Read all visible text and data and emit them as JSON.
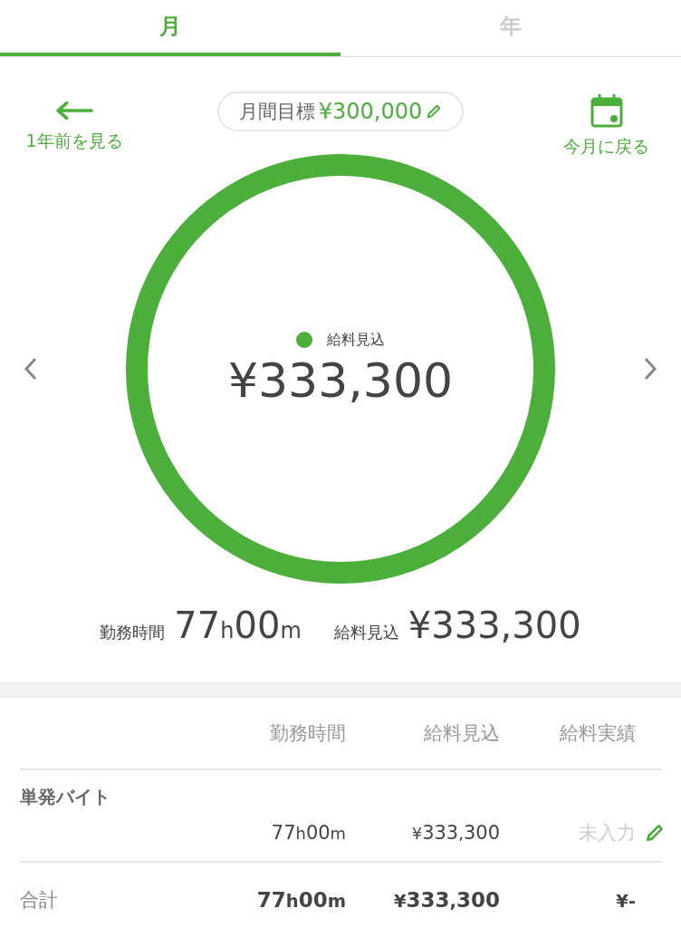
{
  "tabs": [
    {
      "label": "月",
      "selected": true
    },
    {
      "label": "年",
      "selected": false
    }
  ],
  "header": {
    "back_label": "1年前を見る",
    "goal_label": "月間目標",
    "goal_value": "¥300,000",
    "today_label": "今月に戻る"
  },
  "ring": {
    "level": 1,
    "legend": "給料見込",
    "amount": "¥333,300"
  },
  "summary": {
    "hours_label": "勤務時間",
    "hours": "77h00m",
    "salary_label": "給料見込",
    "salary": "¥333,300"
  },
  "table": {
    "columns": [
      "勤務時間",
      "給料見込",
      "給料実績"
    ],
    "groups": [
      {
        "name": "単発バイト",
        "hours": "77h00m",
        "estimate": "¥333,300",
        "actual_placeholder": "未入力"
      }
    ],
    "total": {
      "label": "合計",
      "hours": "77h00m",
      "estimate": "¥333,300",
      "actual": "¥-"
    }
  }
}
